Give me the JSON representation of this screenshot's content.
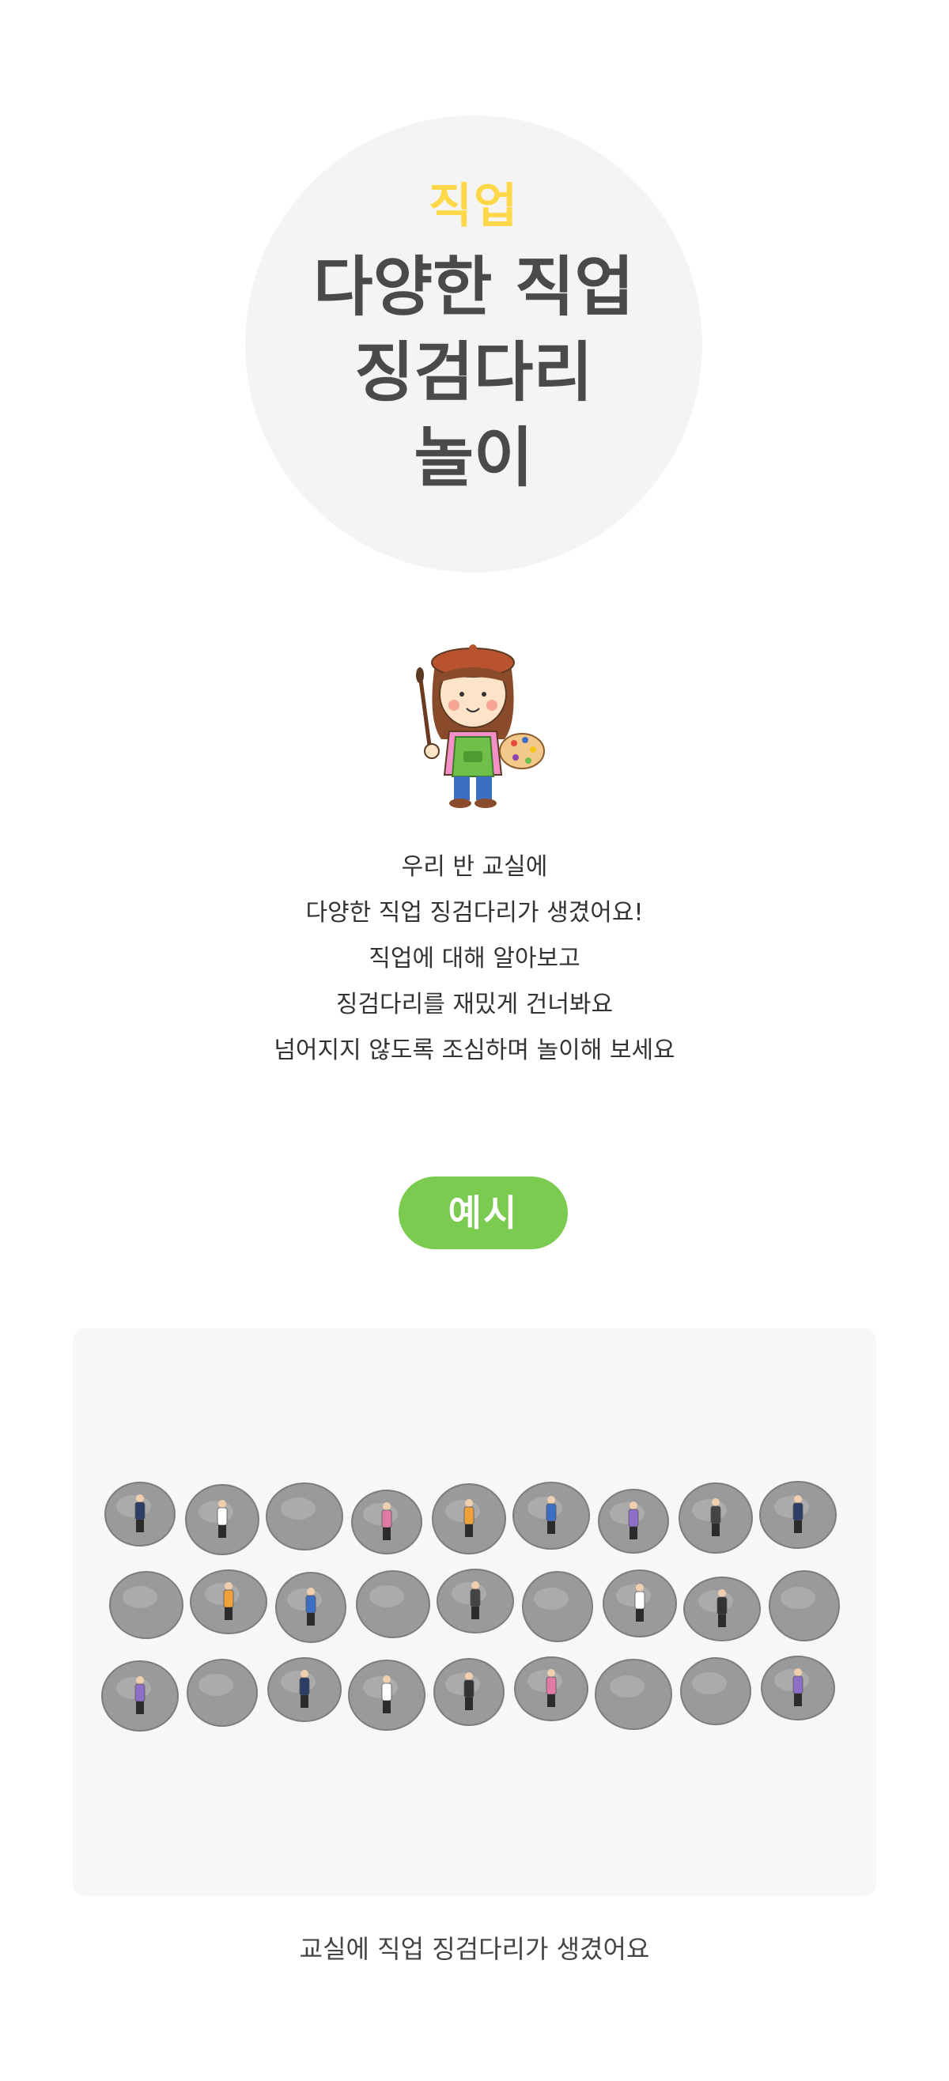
{
  "hero": {
    "category": "직업",
    "title_lines": [
      "다양한 직업",
      "징검다리",
      "놀이"
    ]
  },
  "character_icon": "painter-girl-illustration",
  "intro": {
    "lines": [
      "우리 반 교실에",
      "다양한 직업 징검다리가 생겼어요!",
      "직업에 대해 알아보고",
      "징검다리를 재밌게 건너봐요",
      "넘어지지 않도록 조심하며 놀이해 보세요"
    ]
  },
  "example": {
    "badge_label": "예시",
    "caption": "교실에 직업 징검다리가 생겼어요",
    "stone_rows": [
      [
        {
          "figure": "doctor"
        },
        {
          "figure": "office-worker"
        },
        {
          "figure": "none"
        },
        {
          "figure": "suit-woman"
        },
        {
          "figure": "astronaut"
        },
        {
          "figure": "scientist"
        },
        {
          "figure": "worker"
        },
        {
          "figure": "chef"
        },
        {
          "figure": "ballerina"
        }
      ],
      [
        {
          "figure": "none"
        },
        {
          "figure": "nurse"
        },
        {
          "figure": "barista"
        },
        {
          "figure": "none"
        },
        {
          "figure": "firefighter"
        },
        {
          "figure": "none"
        },
        {
          "figure": "police-officer"
        },
        {
          "figure": "dancer"
        },
        {
          "figure": "none"
        }
      ],
      [
        {
          "figure": "soldier"
        },
        {
          "figure": "none"
        },
        {
          "figure": "lawyer"
        },
        {
          "figure": "businessman"
        },
        {
          "figure": "pharmacist"
        },
        {
          "figure": "soccer-player"
        },
        {
          "figure": "none"
        },
        {
          "figure": "none"
        },
        {
          "figure": "delivery-person"
        }
      ]
    ],
    "colors": {
      "panel_bg": "#f7f7f7",
      "stone": "#9a9a9a",
      "badge": "#7ccb51"
    }
  },
  "colors": {
    "category_yellow": "#ffd84a",
    "title_gray": "#4a4a4a",
    "hero_circle": "#f4f4f4"
  }
}
